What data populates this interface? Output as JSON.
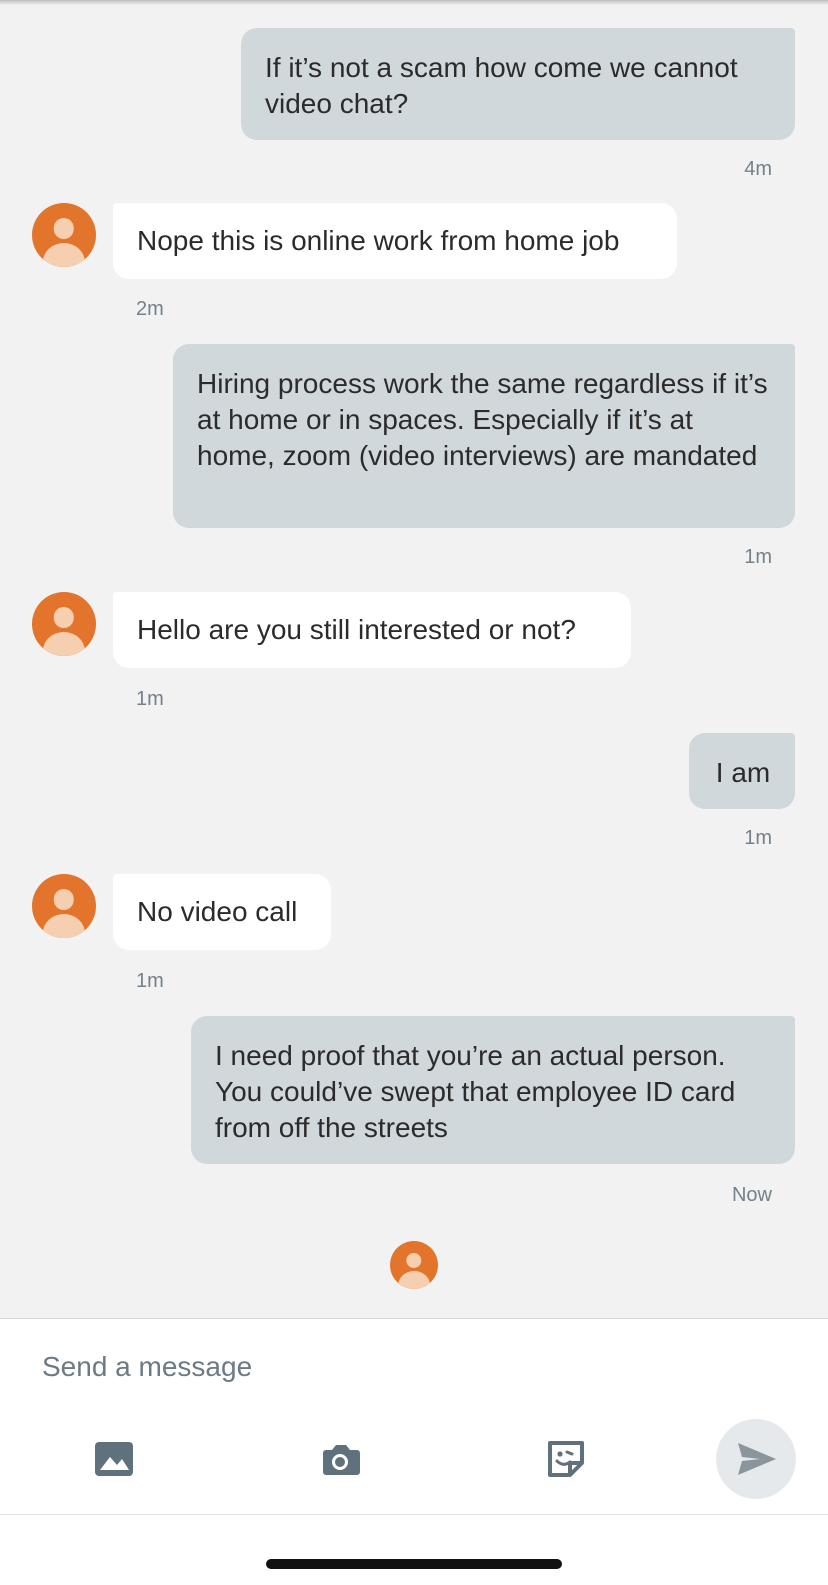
{
  "thread": {
    "messages": [
      {
        "text": "If it’s not a scam how come we cannot video chat?",
        "time": "4m"
      },
      {
        "text": "Nope this is online work from home job",
        "time": "2m"
      },
      {
        "text": "Hiring process work the same regardless if it’s at home or in spaces. Especially if it’s at home, zoom (video interviews) are mandated",
        "time": "1m"
      },
      {
        "text": "Hello are you still interested or not?",
        "time": "1m"
      },
      {
        "text": "I am",
        "time": "1m"
      },
      {
        "text": "No video call",
        "time": "1m"
      },
      {
        "text": "I need proof that you’re an actual person. You could’ve swept that employee ID card from off the streets",
        "time": "Now"
      }
    ]
  },
  "composer": {
    "placeholder": "Send a message",
    "tools": [
      "image-icon",
      "camera-icon",
      "sticker-icon"
    ],
    "send_icon": "send-icon"
  },
  "colors": {
    "outgoing_bubble": "#d0d8dc",
    "incoming_bubble": "#ffffff",
    "avatar": "#e3742c"
  }
}
